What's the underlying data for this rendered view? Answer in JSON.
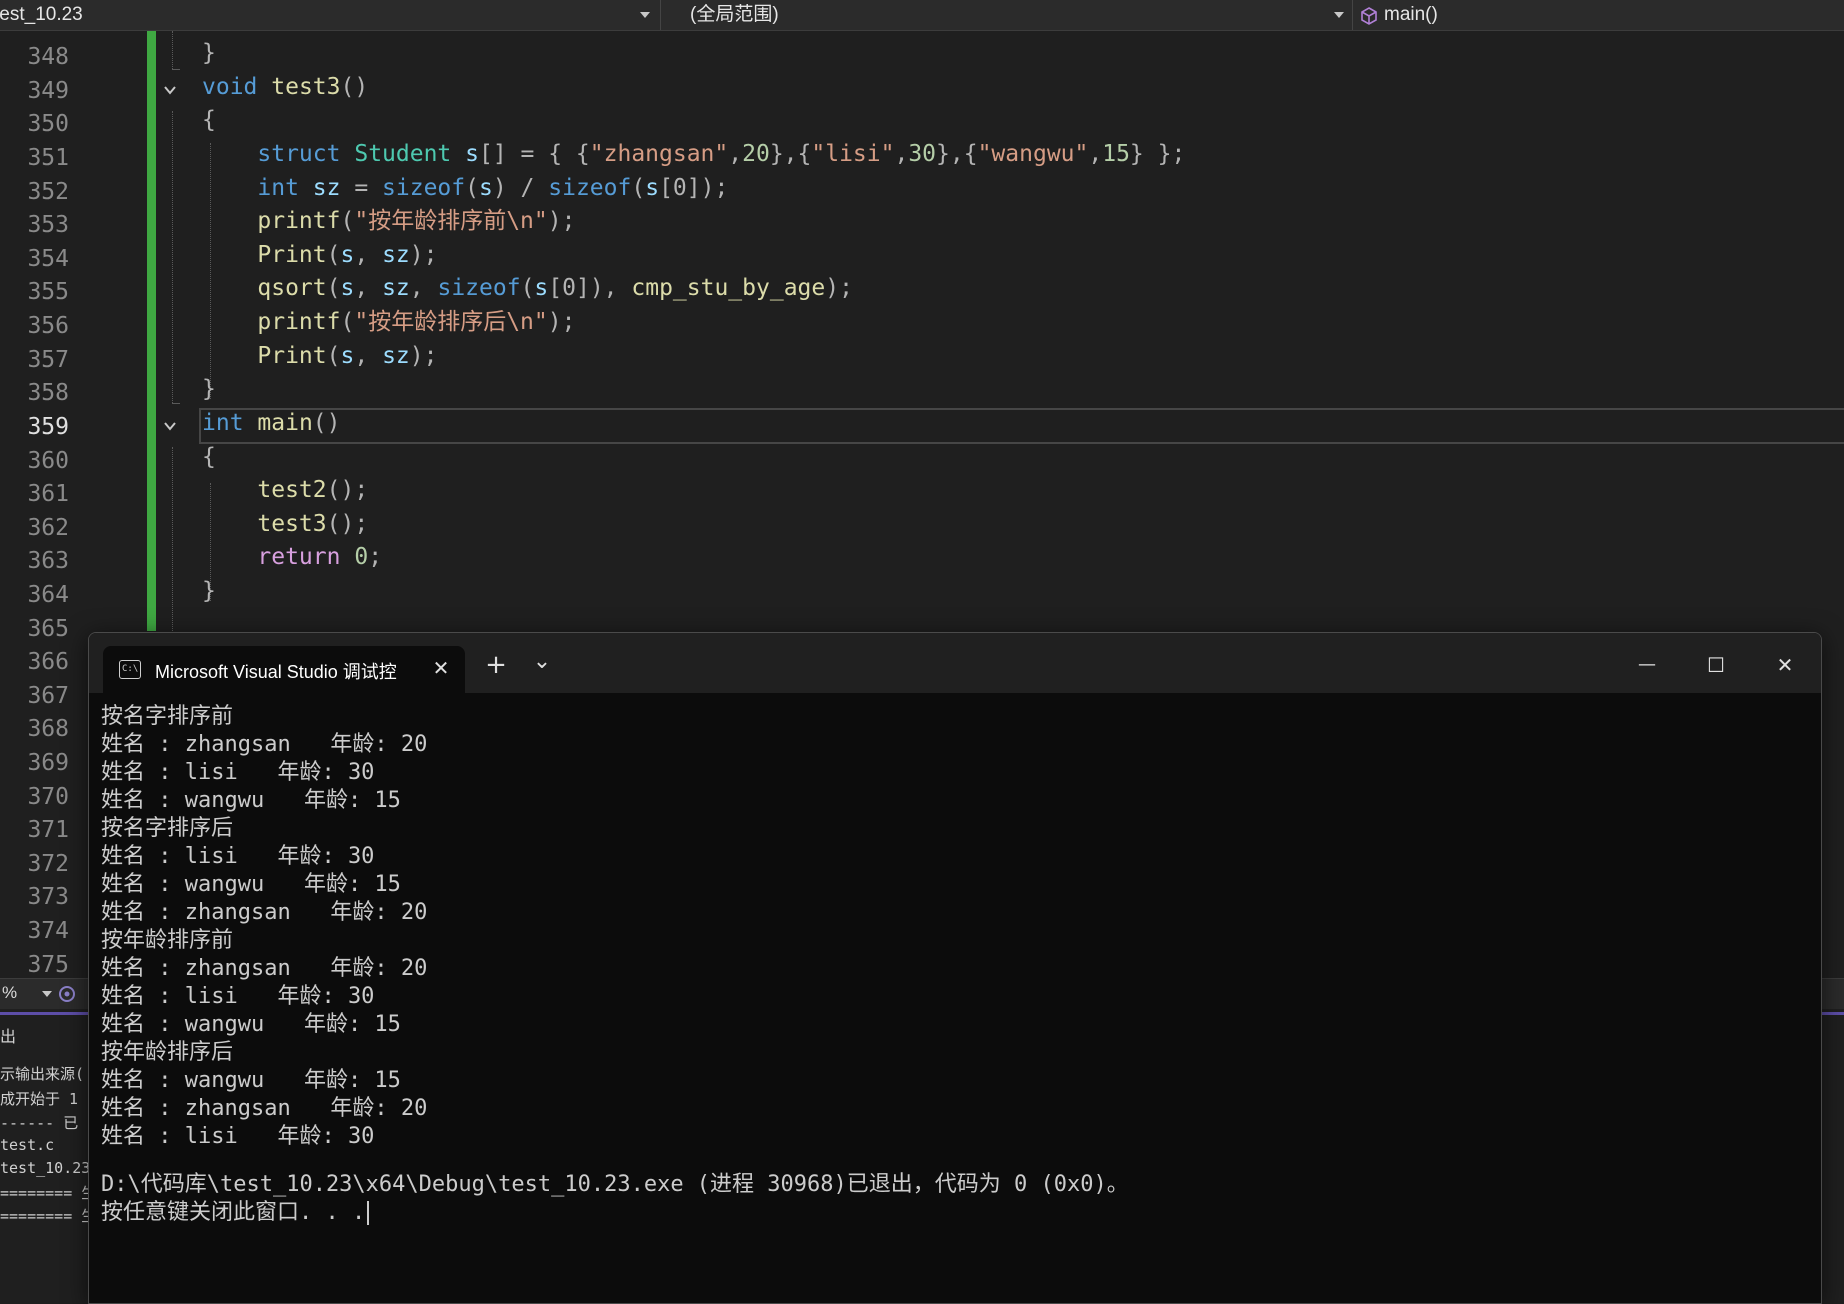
{
  "navbar": {
    "project": "test_10.23",
    "scope": "(全局范围)",
    "member": "main()"
  },
  "editor": {
    "line_numbers": [
      "348",
      "349",
      "350",
      "351",
      "352",
      "353",
      "354",
      "355",
      "356",
      "357",
      "358",
      "359",
      "360",
      "361",
      "362",
      "363",
      "364",
      "365",
      "366",
      "367",
      "368",
      "369",
      "370",
      "371",
      "372",
      "373",
      "374",
      "375"
    ],
    "current_line": "359",
    "code": {
      "l348_brace": "}",
      "l349_kw": "void",
      "l349_fn": "test3",
      "l349_paren": "()",
      "l350_brace": "{",
      "l351_kw": "struct",
      "l351_type": "Student",
      "l351_var": "s",
      "l351_mid": "[] = { {",
      "l351_s1": "\"zhangsan\"",
      "l351_c1": ",",
      "l351_n1": "20",
      "l351_b1": "},{",
      "l351_s2": "\"lisi\"",
      "l351_c2": ",",
      "l351_n2": "30",
      "l351_b2": "},{",
      "l351_s3": "\"wangwu\"",
      "l351_c3": ",",
      "l351_n3": "15",
      "l351_end": "} };",
      "l352_kw": "int",
      "l352_var": "sz",
      "l352_eq": " = ",
      "l352_sz1": "sizeof",
      "l352_a1": "(",
      "l352_s1": "s",
      "l352_a2": ") / ",
      "l352_sz2": "sizeof",
      "l352_a3": "(",
      "l352_s2": "s",
      "l352_a4": "[0]);",
      "l353_fn": "printf",
      "l353_open": "(",
      "l353_str": "\"按年龄排序前\\n\"",
      "l353_close": ");",
      "l354_fn": "Print",
      "l354_open": "(",
      "l354_a": "s",
      "l354_c": ", ",
      "l354_b": "sz",
      "l354_close": ");",
      "l355_fn": "qsort",
      "l355_open": "(",
      "l355_a": "s",
      "l355_c1": ", ",
      "l355_b": "sz",
      "l355_c2": ", ",
      "l355_sz": "sizeof",
      "l355_p1": "(",
      "l355_s": "s",
      "l355_p2": "[0]), ",
      "l355_cmp": "cmp_stu_by_age",
      "l355_close": ");",
      "l356_fn": "printf",
      "l356_open": "(",
      "l356_str": "\"按年龄排序后\\n\"",
      "l356_close": ");",
      "l357_fn": "Print",
      "l357_open": "(",
      "l357_a": "s",
      "l357_c": ", ",
      "l357_b": "sz",
      "l357_close": ");",
      "l358_brace": "}",
      "l359_kw": "int",
      "l359_fn": "main",
      "l359_paren": "()",
      "l360_brace": "{",
      "l361_fn": "test2",
      "l361_rest": "();",
      "l362_fn": "test3",
      "l362_rest": "();",
      "l363_kw": "return",
      "l363_num": "0",
      "l363_semi": ";",
      "l364_brace": "}"
    },
    "zoom": "%"
  },
  "output_pane": {
    "title": "出",
    "lines": [
      "示输出来源(",
      "成开始于 1",
      "------ 已",
      "test.c",
      "test_10.23",
      "======== 生",
      "======== 生"
    ]
  },
  "terminal": {
    "tab_title": "Microsoft Visual Studio 调试控",
    "close_tab": "✕",
    "new_tab": "+",
    "dropdown": "⌄",
    "minimize": "—",
    "maximize": "☐",
    "close": "✕",
    "lines": [
      "按名字排序前",
      "姓名 : zhangsan   年龄: 20",
      "姓名 : lisi   年龄: 30",
      "姓名 : wangwu   年龄: 15",
      "按名字排序后",
      "姓名 : lisi   年龄: 30",
      "姓名 : wangwu   年龄: 15",
      "姓名 : zhangsan   年龄: 20",
      "按年龄排序前",
      "姓名 : zhangsan   年龄: 20",
      "姓名 : lisi   年龄: 30",
      "姓名 : wangwu   年龄: 15",
      "按年龄排序后",
      "姓名 : wangwu   年龄: 15",
      "姓名 : zhangsan   年龄: 20",
      "姓名 : lisi   年龄: 30",
      "",
      "D:\\代码库\\test_10.23\\x64\\Debug\\test_10.23.exe (进程 30968)已退出，代码为 0 (0x0)。",
      "按任意键关闭此窗口. . ."
    ]
  }
}
